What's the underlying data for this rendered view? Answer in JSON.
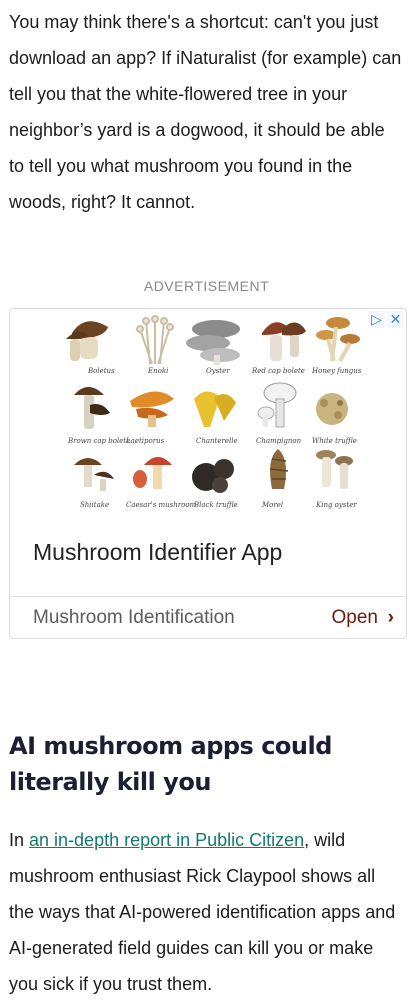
{
  "article": {
    "intro_paragraph": "You may think there's a shortcut: can't you just download an app? If iNaturalist (for example) can tell you that the white-flowered tree in your neighbor’s yard is a dogwood, it should be able to tell you what mushroom you found in the woods, right? It cannot.",
    "heading": "AI mushroom apps could literally kill you",
    "body_prefix": "In ",
    "body_link": "an in-depth report in Public Citizen",
    "body_suffix": ", wild mushroom enthusiast Rick Claypool shows all the ways that AI-powered identification apps and AI-generated field guides can kill you or make you sick if you trust them."
  },
  "ad": {
    "label": "ADVERTISEMENT",
    "title": "Mushroom Identifier App",
    "subtitle": "Mushroom Identification",
    "cta": "Open",
    "cta_chevron": "›",
    "choices_icon": "ad-choices-icon",
    "close_icon": "close-icon",
    "mushrooms": [
      "Boletus",
      "Enoki",
      "Oyster",
      "Red cap bolete",
      "Honey fungus",
      "Brown cap bolete",
      "Laetiporus",
      "Chanterelle",
      "Champignon",
      "White truffle",
      "Shiitake",
      "Caesar's mushroom",
      "Black truffle",
      "Morel",
      "King oyster"
    ]
  }
}
